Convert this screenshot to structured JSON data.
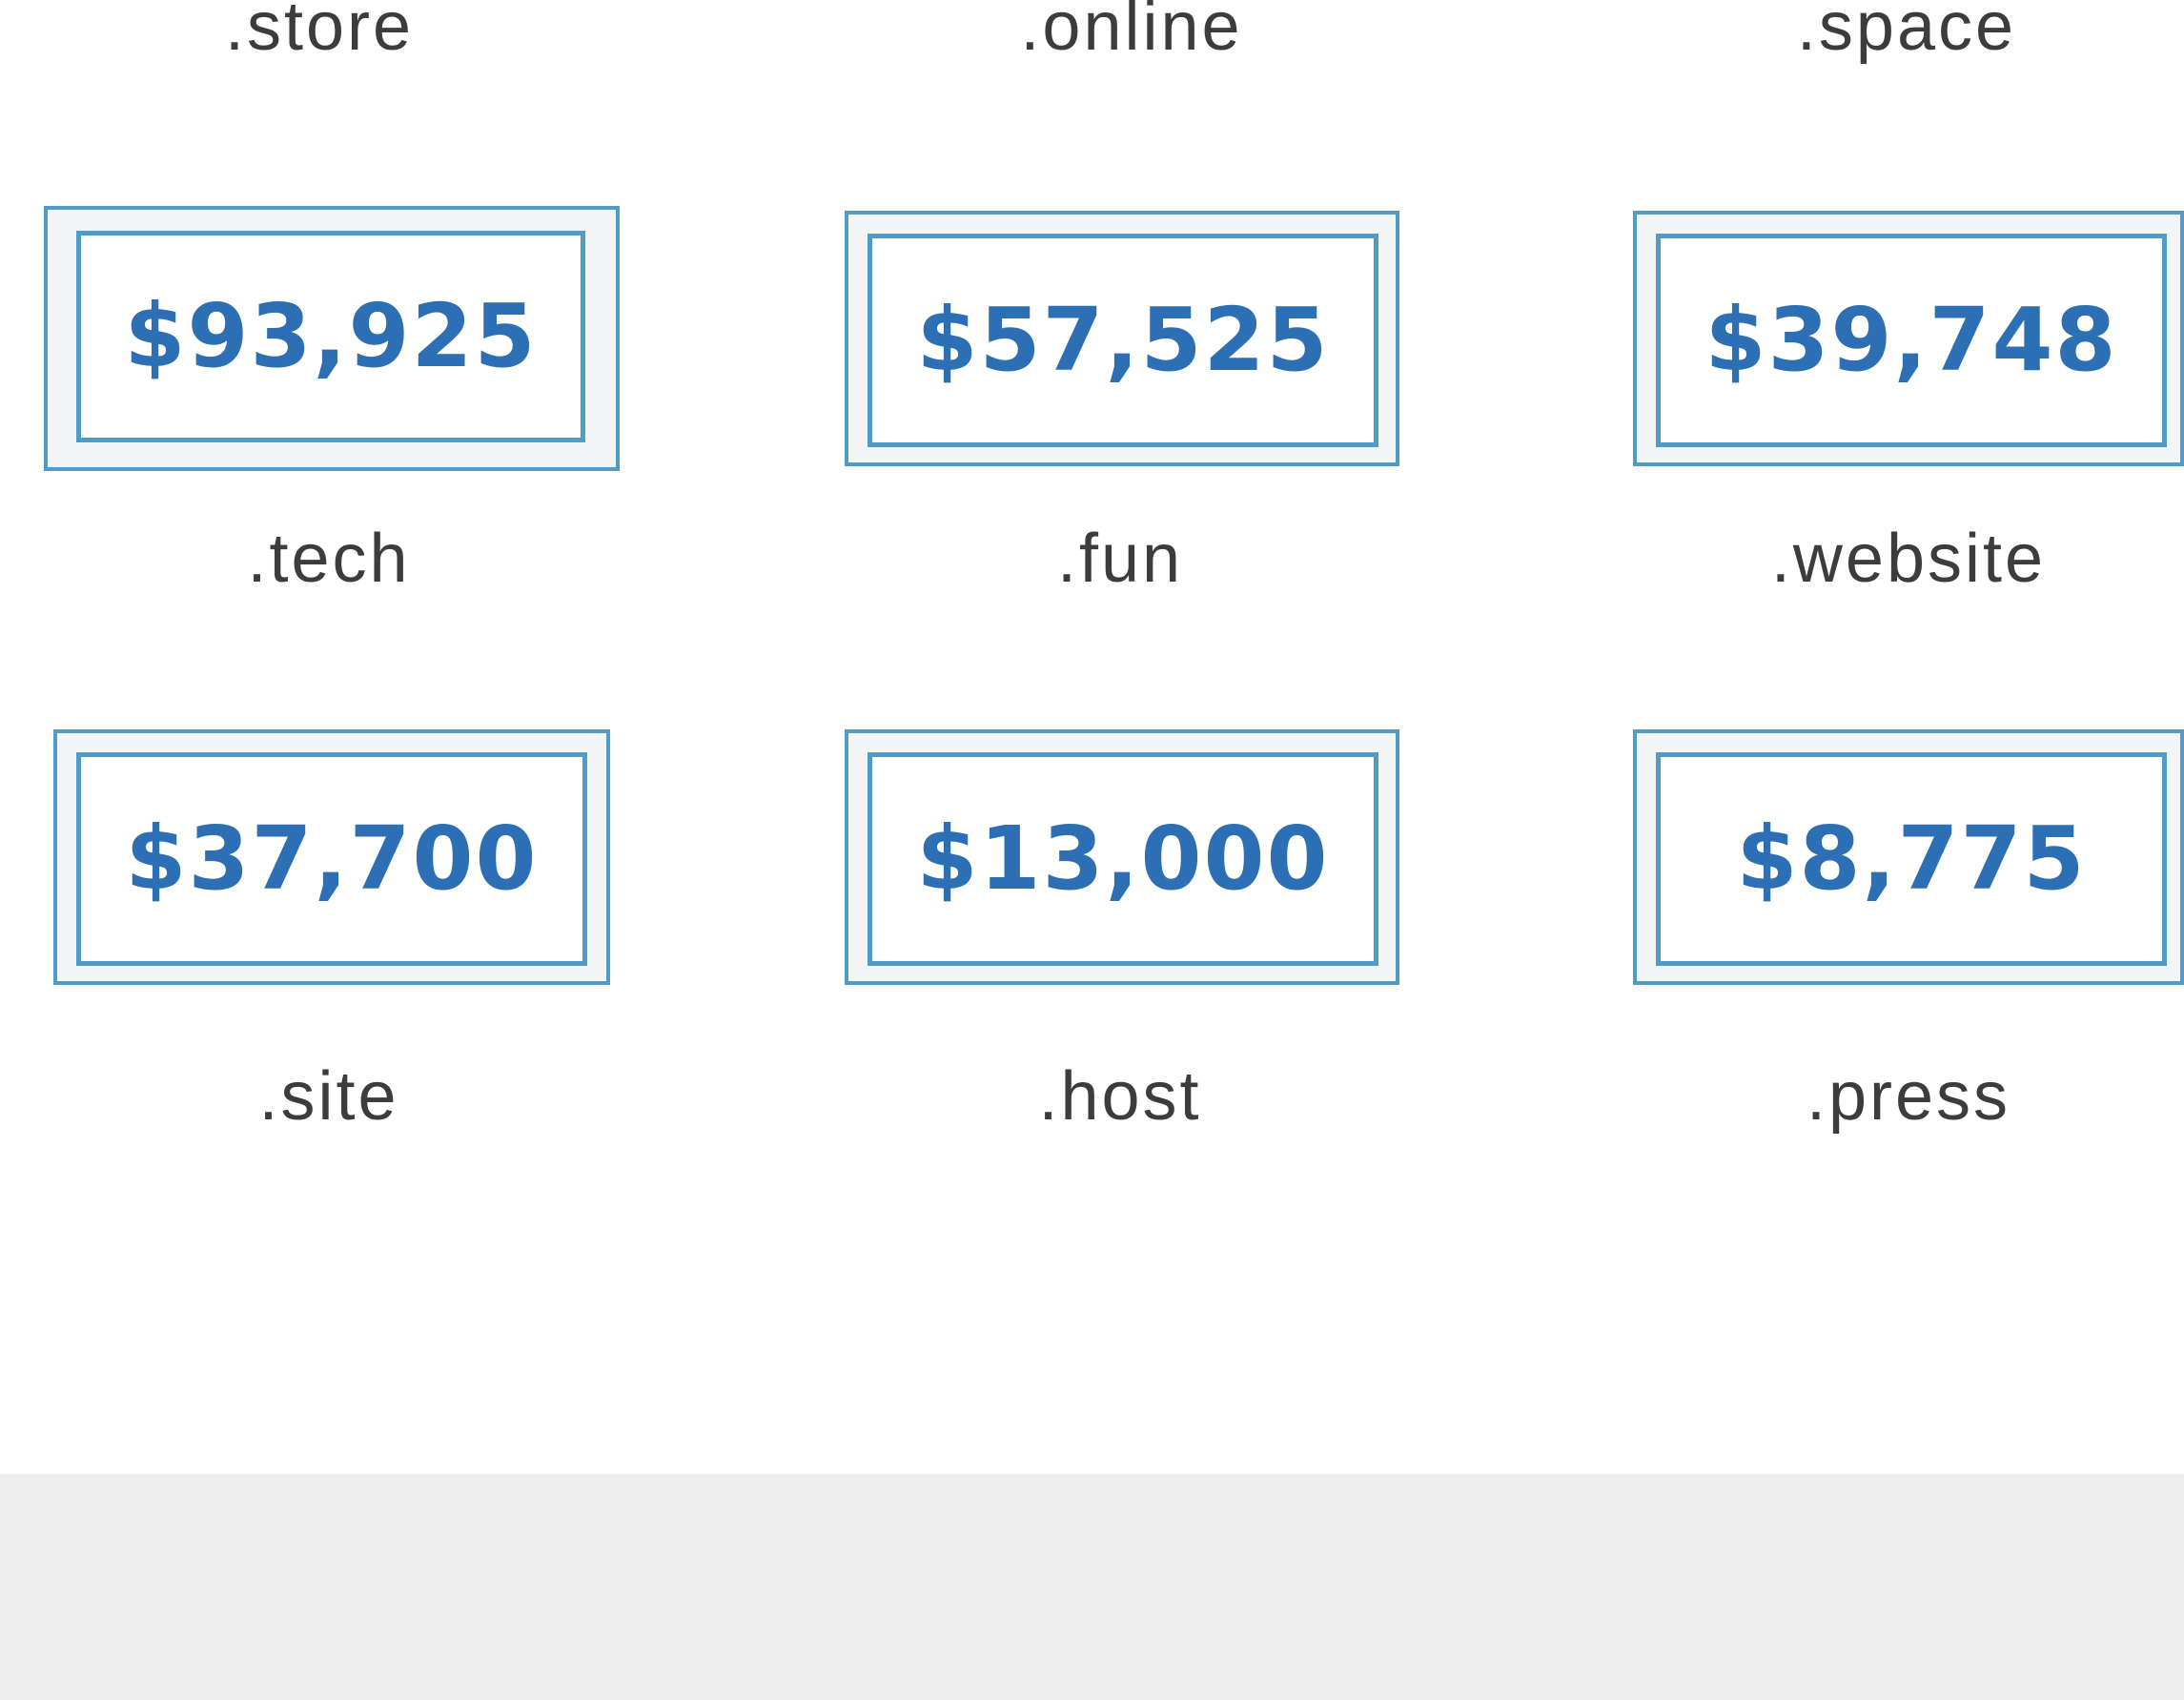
{
  "top_labels": [
    ".store",
    ".online",
    ".space"
  ],
  "domains": [
    {
      "tld": ".tech",
      "price": "$93,925"
    },
    {
      "tld": ".fun",
      "price": "$57,525"
    },
    {
      "tld": ".website",
      "price": "$39,748"
    },
    {
      "tld": ".site",
      "price": "$37,700"
    },
    {
      "tld": ".host",
      "price": "$13,000"
    },
    {
      "tld": ".press",
      "price": "$8,775"
    }
  ],
  "colors": {
    "price_text": "#2d6fb5",
    "frame_border": "#4f9cc9",
    "label_text": "#3c3c3c",
    "footer_bg": "#eeeeee"
  }
}
